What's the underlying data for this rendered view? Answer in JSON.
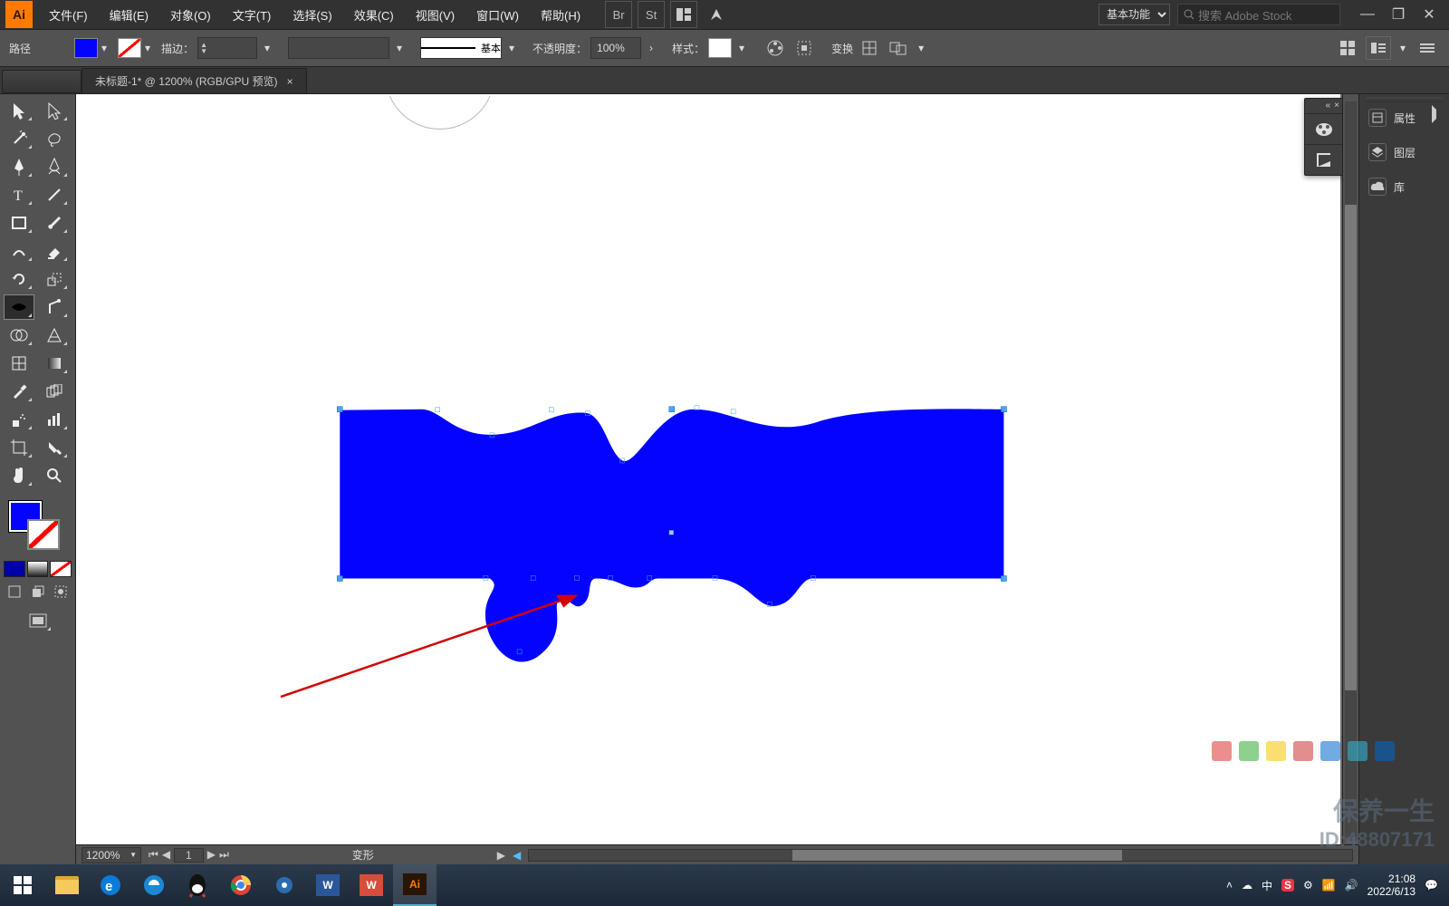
{
  "menu": {
    "items": [
      "文件(F)",
      "编辑(E)",
      "对象(O)",
      "文字(T)",
      "选择(S)",
      "效果(C)",
      "视图(V)",
      "窗口(W)",
      "帮助(H)"
    ],
    "workspace": "基本功能",
    "search_placeholder": "搜索 Adobe Stock",
    "logo": "Ai"
  },
  "optbar": {
    "mode": "路径",
    "stroke_label": "描边：",
    "stroke_width": "",
    "profile_label": "基本",
    "opacity_label": "不透明度：",
    "opacity_value": "100%",
    "style_label": "样式：",
    "transform_label": "变换"
  },
  "tab": {
    "title": "未标题-1* @ 1200% (RGB/GPU 预览)"
  },
  "status": {
    "zoom": "1200%",
    "art_index": "1",
    "tool": "变形"
  },
  "rpanels": {
    "items": [
      "属性",
      "图层",
      "库"
    ]
  },
  "taskbar": {
    "time": "21:08",
    "date": "2022/6/13",
    "ime": "中"
  },
  "colors": {
    "fill": "#0303ff",
    "accent": "#ff7b00"
  },
  "watermark": {
    "line1": "保养一生",
    "line2": "ID:48807171"
  }
}
